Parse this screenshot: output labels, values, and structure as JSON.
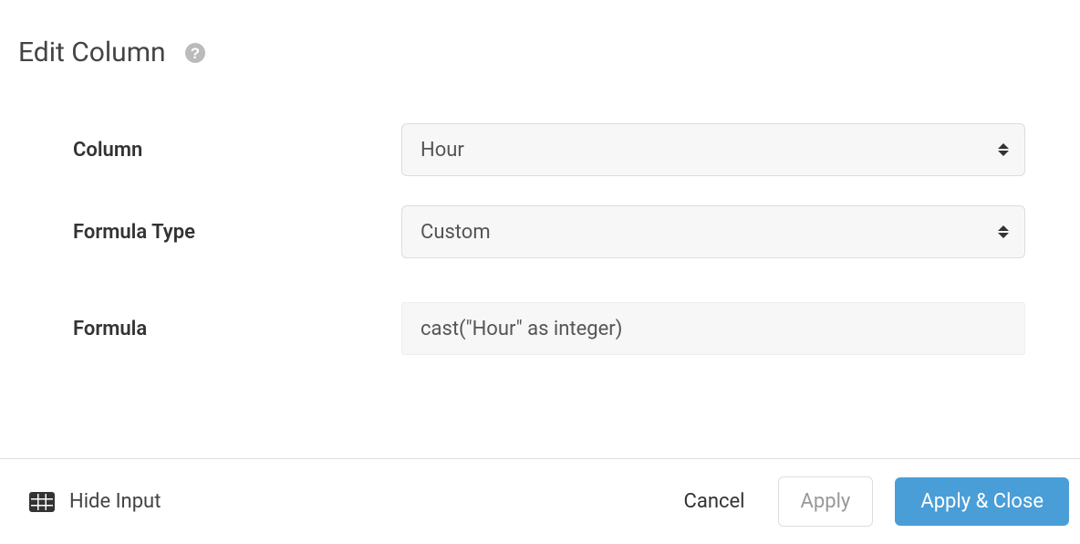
{
  "header": {
    "title": "Edit Column"
  },
  "form": {
    "column_label": "Column",
    "column_value": "Hour",
    "formula_type_label": "Formula Type",
    "formula_type_value": "Custom",
    "formula_label": "Formula",
    "formula_value": "cast(\"Hour\" as integer)"
  },
  "footer": {
    "hide_input_label": "Hide Input",
    "cancel_label": "Cancel",
    "apply_label": "Apply",
    "apply_close_label": "Apply & Close"
  }
}
